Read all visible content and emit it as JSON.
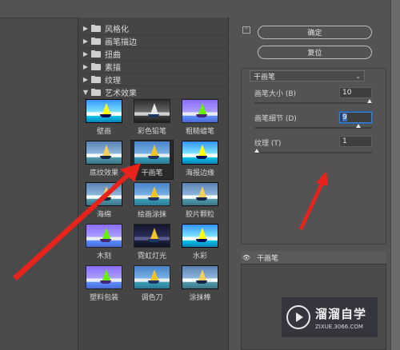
{
  "categories": [
    {
      "label": "风格化",
      "expanded": false
    },
    {
      "label": "画笔描边",
      "expanded": false
    },
    {
      "label": "扭曲",
      "expanded": false
    },
    {
      "label": "素描",
      "expanded": false
    },
    {
      "label": "纹理",
      "expanded": false
    },
    {
      "label": "艺术效果",
      "expanded": true
    }
  ],
  "thumbnails": [
    {
      "label": "壁画"
    },
    {
      "label": "彩色铅笔"
    },
    {
      "label": "粗糙蜡笔"
    },
    {
      "label": "底纹效果"
    },
    {
      "label": "干画笔",
      "selected": true
    },
    {
      "label": "海报边缘"
    },
    {
      "label": "海绵"
    },
    {
      "label": "绘画涂抹"
    },
    {
      "label": "胶片颗粒"
    },
    {
      "label": "木刻"
    },
    {
      "label": "霓虹灯光"
    },
    {
      "label": "水彩"
    },
    {
      "label": "塑料包装"
    },
    {
      "label": "调色刀"
    },
    {
      "label": "涂抹棒"
    }
  ],
  "buttons": {
    "ok": "确定",
    "reset": "复位"
  },
  "filter_select": {
    "value": "干画笔"
  },
  "params": [
    {
      "label": "画笔大小 (B)",
      "value": "10",
      "slider_fraction": 1.0
    },
    {
      "label": "画笔细节 (D)",
      "value": "9",
      "slider_fraction": 0.9
    },
    {
      "label": "纹理 (T)",
      "value": "1",
      "slider_fraction": 0.0
    }
  ],
  "layer": {
    "name": "干画笔"
  },
  "watermark": {
    "title": "溜溜自学",
    "url": "ZIXUE.3066.COM"
  },
  "colors": {
    "background": "#535353",
    "annotation_arrow": "#e8231c",
    "focus": "#3a84d8"
  }
}
